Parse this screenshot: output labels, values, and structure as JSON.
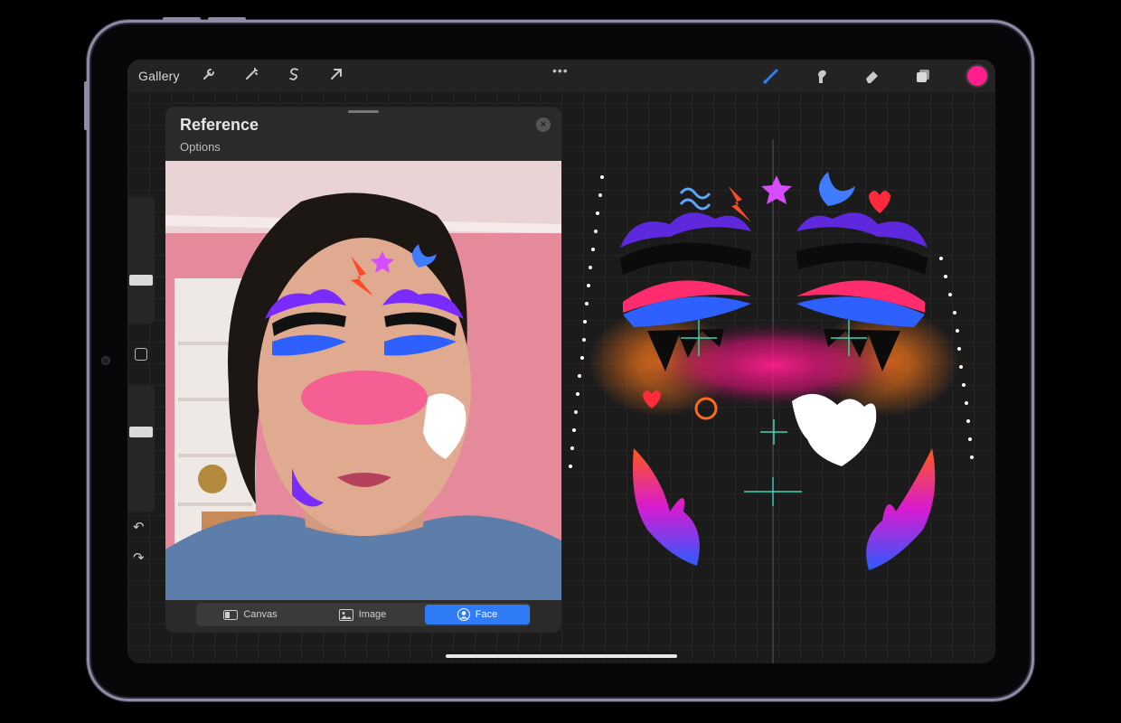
{
  "topbar": {
    "gallery_label": "Gallery",
    "more_label": "•••",
    "icons": [
      "wrench-icon",
      "magic-wand-icon",
      "selection-icon",
      "transform-arrow-icon",
      "brush-icon",
      "smudge-icon",
      "eraser-icon",
      "layers-icon"
    ],
    "current_color": "#ff1e8c"
  },
  "reference_panel": {
    "title": "Reference",
    "options_label": "Options",
    "close_label": "×",
    "tabs": [
      {
        "label": "Canvas",
        "active": false
      },
      {
        "label": "Image",
        "active": false
      },
      {
        "label": "Face",
        "active": true
      }
    ]
  },
  "sidebar": {
    "undo_label": "↶",
    "redo_label": "↷"
  }
}
